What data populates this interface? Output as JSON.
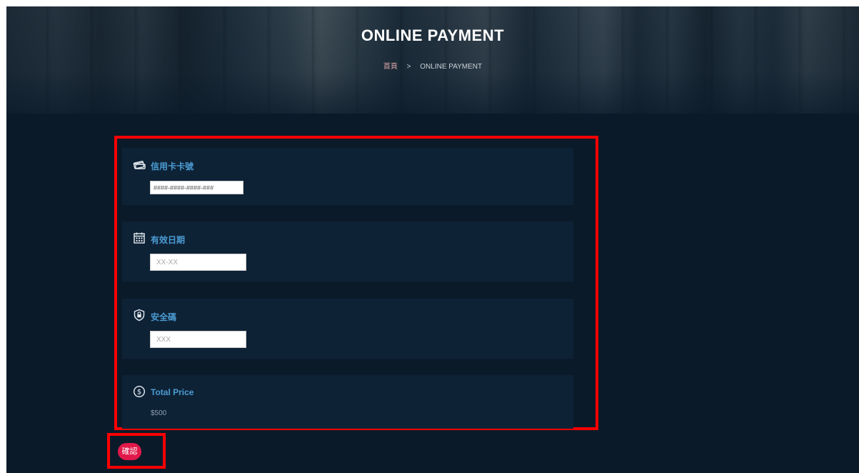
{
  "hero": {
    "title": "ONLINE PAYMENT",
    "breadcrumb": {
      "home": "首頁",
      "separator": ">",
      "current": "ONLINE PAYMENT"
    }
  },
  "form": {
    "card_number": {
      "icon": "credit-card-icon",
      "label": "信用卡卡號",
      "value": "####-####-####-###"
    },
    "expiry": {
      "icon": "calendar-icon",
      "label": "有效日期",
      "placeholder": "XX-XX"
    },
    "security_code": {
      "icon": "shield-lock-icon",
      "label": "安全碼",
      "placeholder": "XXX"
    },
    "total": {
      "icon": "dollar-coin-icon",
      "label": "Total Price",
      "value": "$500"
    }
  },
  "actions": {
    "confirm_label": "確認"
  },
  "colors": {
    "background": "#0a1a29",
    "card": "#0e2236",
    "label": "#4b9cd3",
    "confirm": "#e0194a",
    "highlight": "#ff0000"
  }
}
